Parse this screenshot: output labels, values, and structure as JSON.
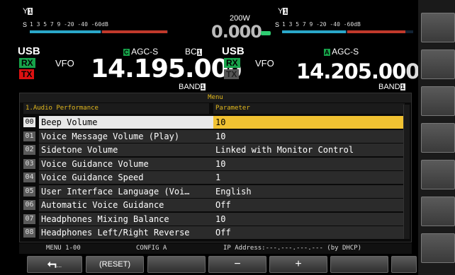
{
  "left": {
    "s_meter_scale": "1  3  5  7  9   -20  -40 -60dB",
    "mode": "USB",
    "vfo": "VFO",
    "agc": "AGC-S",
    "agc_icon": "C",
    "bc": "BC",
    "bc_num": "1",
    "frequency_main": "14.195.00",
    "frequency_last": "0",
    "band_label": "BAND",
    "band_num": "1",
    "rx_label": "RX",
    "tx_label": "TX",
    "antenna_num": "1"
  },
  "center": {
    "power": "200W",
    "digits": "0.000"
  },
  "right": {
    "s_meter_scale": "1  3  5  7  9   -20  -40 -60dB",
    "mode": "USB",
    "vfo": "VFO",
    "agc": "AGC-S",
    "agc_icon": "A",
    "frequency_main": "14.205.00",
    "frequency_last": "0",
    "band_label": "BAND",
    "band_num": "1",
    "rx_label": "RX",
    "tx_label": "TX",
    "antenna_num": "1"
  },
  "menu": {
    "title": "Menu",
    "category": "1.Audio Performance",
    "parameter_header": "Parameter",
    "items": [
      {
        "num": "00",
        "name": "Beep Volume",
        "value": "10"
      },
      {
        "num": "01",
        "name": "Voice Message Volume (Play)",
        "value": "10"
      },
      {
        "num": "02",
        "name": "Sidetone Volume",
        "value": "Linked with Monitor Control"
      },
      {
        "num": "03",
        "name": "Voice Guidance Volume",
        "value": "10"
      },
      {
        "num": "04",
        "name": "Voice Guidance Speed",
        "value": "1"
      },
      {
        "num": "05",
        "name": "User Interface Language (Voi…",
        "value": "English"
      },
      {
        "num": "06",
        "name": "Automatic Voice Guidance",
        "value": "Off"
      },
      {
        "num": "07",
        "name": "Headphones Mixing Balance",
        "value": "10"
      },
      {
        "num": "08",
        "name": "Headphones Left/Right Reverse",
        "value": "Off"
      }
    ]
  },
  "status": {
    "menu": "MENU 1-00",
    "config": "CONFIG A",
    "ip": "IP Address:---.---.---.--- (by DHCP)"
  },
  "softkeys": {
    "back_sub": "...",
    "reset": "(RESET)",
    "minus": "−",
    "plus": "+"
  },
  "colors": {
    "selected_value": "#f1c232",
    "menu_header_text": "#e3b91d",
    "rx_green": "#17a34a",
    "tx_red": "#dd1111"
  }
}
